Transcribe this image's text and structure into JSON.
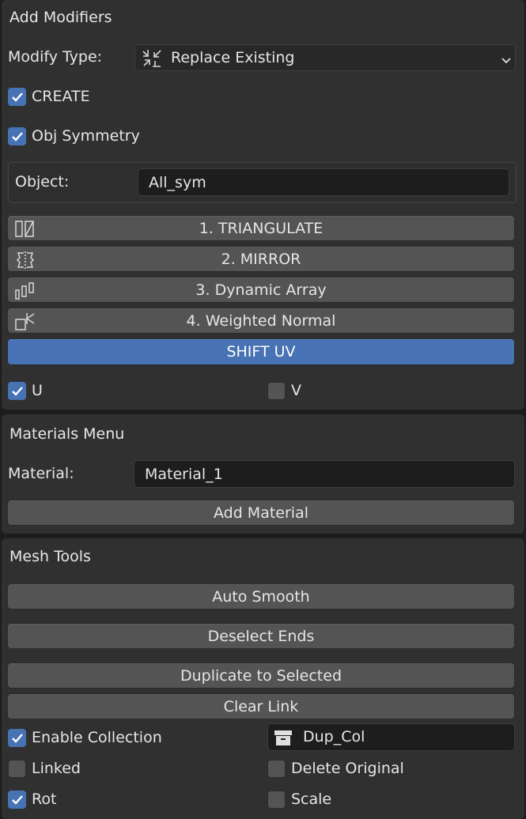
{
  "add_modifiers": {
    "title": "Add Modifiers",
    "modify_type_label": "Modify Type:",
    "modify_type_value": "Replace Existing",
    "create_label": "CREATE",
    "create_checked": true,
    "obj_symmetry_label": "Obj Symmetry",
    "obj_symmetry_checked": true,
    "object_label": "Object:",
    "object_value": "All_sym",
    "buttons": [
      {
        "label": "1. TRIANGULATE",
        "icon": "triangulate-icon"
      },
      {
        "label": "2. MIRROR",
        "icon": "mirror-icon"
      },
      {
        "label": "3. Dynamic Array",
        "icon": "array-icon"
      },
      {
        "label": "4. Weighted Normal",
        "icon": "weighted-normal-icon"
      }
    ],
    "shift_uv_label": "SHIFT UV",
    "u_label": "U",
    "u_checked": true,
    "v_label": "V",
    "v_checked": false
  },
  "materials_menu": {
    "title": "Materials Menu",
    "material_label": "Material:",
    "material_value": "Material_1",
    "add_material_label": "Add Material"
  },
  "mesh_tools": {
    "title": "Mesh Tools",
    "auto_smooth_label": "Auto Smooth",
    "deselect_ends_label": "Deselect Ends",
    "duplicate_label": "Duplicate to Selected",
    "clear_link_label": "Clear Link",
    "enable_collection_label": "Enable Collection",
    "enable_collection_checked": true,
    "collection_value": "Dup_Col",
    "collection_icon": "collection-box-icon",
    "linked_label": "Linked",
    "linked_checked": false,
    "delete_original_label": "Delete Original",
    "delete_original_checked": false,
    "rot_label": "Rot",
    "rot_checked": true,
    "scale_label": "Scale",
    "scale_checked": false
  },
  "colors": {
    "accent": "#4772b3",
    "panel": "#303030",
    "button": "#545454",
    "field": "#1d1d1d"
  }
}
